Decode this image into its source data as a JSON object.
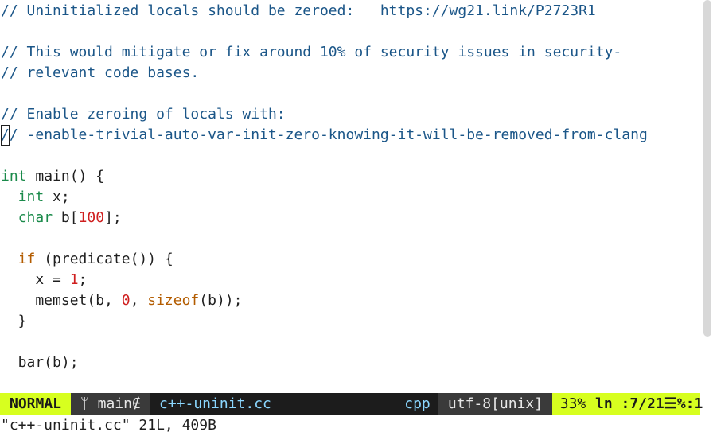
{
  "editor": {
    "lines": [
      [
        {
          "t": "// Uninitialized locals should be zeroed:   https://wg21.link/P2723R1",
          "c": "comment"
        }
      ],
      [],
      [
        {
          "t": "// This would mitigate or fix around 10% of security issues in security-",
          "c": "comment"
        }
      ],
      [
        {
          "t": "// relevant code bases.",
          "c": "comment"
        }
      ],
      [],
      [
        {
          "t": "// Enable zeroing of locals with:",
          "c": "comment"
        }
      ],
      [
        {
          "t": "/",
          "c": "comment",
          "cursor": true
        },
        {
          "t": "/ -enable-trivial-auto-var-init-zero-knowing-it-will-be-removed-from-clang",
          "c": "comment"
        }
      ],
      [],
      [
        {
          "t": "int",
          "c": "type"
        },
        {
          "t": " main() {",
          "c": "plain"
        }
      ],
      [
        {
          "t": "  ",
          "c": "plain"
        },
        {
          "t": "int",
          "c": "type"
        },
        {
          "t": " x;",
          "c": "plain"
        }
      ],
      [
        {
          "t": "  ",
          "c": "plain"
        },
        {
          "t": "char",
          "c": "type"
        },
        {
          "t": " b[",
          "c": "plain"
        },
        {
          "t": "100",
          "c": "num"
        },
        {
          "t": "];",
          "c": "plain"
        }
      ],
      [],
      [
        {
          "t": "  ",
          "c": "plain"
        },
        {
          "t": "if",
          "c": "kw"
        },
        {
          "t": " (predicate()) {",
          "c": "plain"
        }
      ],
      [
        {
          "t": "    x = ",
          "c": "plain"
        },
        {
          "t": "1",
          "c": "num"
        },
        {
          "t": ";",
          "c": "plain"
        }
      ],
      [
        {
          "t": "    memset(b, ",
          "c": "plain"
        },
        {
          "t": "0",
          "c": "num"
        },
        {
          "t": ", ",
          "c": "plain"
        },
        {
          "t": "sizeof",
          "c": "kw"
        },
        {
          "t": "(b));",
          "c": "plain"
        }
      ],
      [
        {
          "t": "  }",
          "c": "plain"
        }
      ],
      [],
      [
        {
          "t": "  bar(b);",
          "c": "plain"
        }
      ]
    ]
  },
  "scrollbar": {
    "visible_fraction": 0.857
  },
  "statusline": {
    "mode": "NORMAL",
    "branch_icon": "git-branch-icon",
    "branch": "ᛘ main∉",
    "filename": "c++-uninit.cc",
    "filetype": "cpp",
    "encoding": "utf-8[unix]",
    "percent": "33%",
    "position": "ln :7/21☰%:1"
  },
  "cmdline": {
    "message": "\"c++-uninit.cc\" 21L, 409B"
  },
  "colors": {
    "comment": "#1b5688",
    "type": "#1a8a4a",
    "keyword": "#b35c00",
    "number": "#cf1f1f",
    "mode_bg": "#d7ff1f",
    "statusline_bg": "#1c1c1c"
  }
}
